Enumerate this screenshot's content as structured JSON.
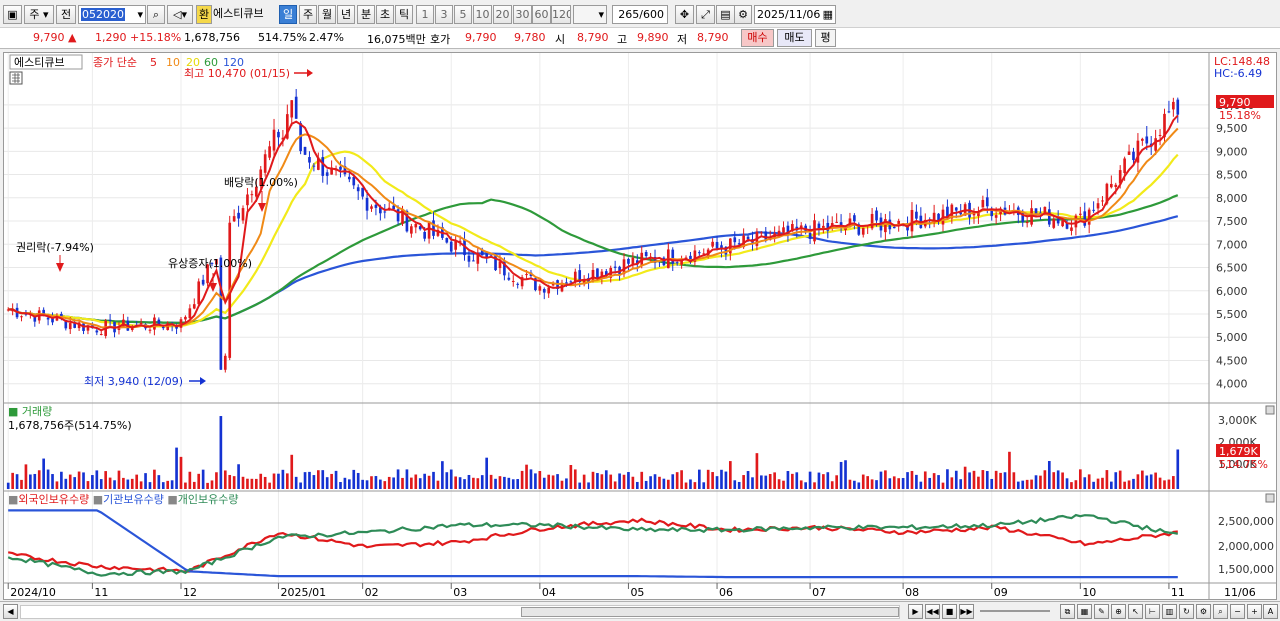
{
  "toolbar": {
    "period": "주",
    "prev": "전",
    "code": "052020",
    "exchange": "환",
    "name": "에스티큐브",
    "timeframes": [
      "일",
      "주",
      "월",
      "년",
      "분",
      "초",
      "틱"
    ],
    "selected_timeframe": "일",
    "intervals": [
      "1",
      "3",
      "5",
      "10",
      "20",
      "30",
      "60",
      "120"
    ],
    "count_display": "265/600",
    "date": "2025/11/06"
  },
  "quote": {
    "price": "9,790 ▲",
    "change": "1,290",
    "change_pct": "+15.18%",
    "volume": "1,678,756",
    "volume_ratio": "514.75%",
    "turnover_rate": "2.47%",
    "amount": "16,075백만",
    "bid_label": "호가",
    "ask": "9,790",
    "bid": "9,780",
    "open_label": "시",
    "open": "8,790",
    "high_label": "고",
    "high": "9,890",
    "low_label": "저",
    "low": "8,790",
    "buy_button": "매수",
    "sell_button": "매도",
    "eval_button": "평"
  },
  "legend": {
    "name": "에스티큐브",
    "ma_label": "종가 단순",
    "ma_periods": [
      "5",
      "10",
      "20",
      "60",
      "120"
    ],
    "ma_colors": [
      "#e0191b",
      "#f08a16",
      "#f2ea1a",
      "#2e9a3a",
      "#2a55d8"
    ]
  },
  "price_panel": {
    "lc": "LC:148.48",
    "hc": "HC:-6.49",
    "y_ticks": [
      "10,000",
      "9,500",
      "9,000",
      "8,500",
      "8,000",
      "7,500",
      "7,000",
      "6,500",
      "6,000",
      "5,500",
      "5,000",
      "4,500",
      "4,000"
    ],
    "current_price_tag": "9,790",
    "current_pct_tag": "15.18%",
    "annotations": {
      "high": "최고 10,470 (01/15)",
      "low": "최저 3,940 (12/09)",
      "rights": "권리락(-7.94%)",
      "paid_increase": "유상증자(1.00%)",
      "dividend": "배당락(1.00%)"
    }
  },
  "volume_panel": {
    "title": "거래량",
    "value": "1,678,756주(514.75%)",
    "y_ticks": [
      "3,000K",
      "2,000K",
      "1,000K"
    ],
    "current_tag": "1,679K",
    "current_pct_tag": "514.75%"
  },
  "holding_panel": {
    "series": [
      "외국인보유수량",
      "기관보유수량",
      "개인보유수량"
    ],
    "colors": [
      "#e0191b",
      "#2a55d8",
      "#2e8b57"
    ],
    "y_ticks": [
      "2,500,000",
      "2,000,000",
      "1,500,000"
    ]
  },
  "x_axis": {
    "labels": [
      "2024/10",
      "11",
      "12",
      "2025/01",
      "02",
      "03",
      "04",
      "05",
      "06",
      "07",
      "08",
      "09",
      "10",
      "11"
    ],
    "right_label": "11/06"
  },
  "chart_data": {
    "type": "candlestick",
    "title": "에스티큐브",
    "x_range": [
      "2024/10",
      "2025/11/06"
    ],
    "ylim": [
      3940,
      10470
    ],
    "monthly_close_approx": [
      {
        "x": "2024/10",
        "y": 5600
      },
      {
        "x": "2024/11",
        "y": 5200
      },
      {
        "x": "2024/12",
        "y": 5300
      },
      {
        "x": "2025/01",
        "y": 9400
      },
      {
        "x": "2025/02",
        "y": 8000
      },
      {
        "x": "2025/03",
        "y": 7000
      },
      {
        "x": "2025/04",
        "y": 6100
      },
      {
        "x": "2025/05",
        "y": 6600
      },
      {
        "x": "2025/06",
        "y": 6900
      },
      {
        "x": "2025/07",
        "y": 7300
      },
      {
        "x": "2025/08",
        "y": 7500
      },
      {
        "x": "2025/09",
        "y": 7800
      },
      {
        "x": "2025/10",
        "y": 7500
      },
      {
        "x": "2025/11",
        "y": 9790
      }
    ],
    "series": [
      {
        "name": "외국인보유수량",
        "values_approx": [
          1850000,
          1600000,
          1500000,
          2300000,
          2000000,
          2100000,
          2400000,
          2550000,
          2350000,
          2400000,
          2300000,
          2400000,
          2050000,
          2300000
        ]
      },
      {
        "name": "기관보유수량",
        "values_approx": [
          2750000,
          2750000,
          1500000,
          1400000,
          1400000,
          1400000,
          1400000,
          1400000,
          1380000,
          1380000,
          1380000,
          1380000,
          1380000,
          1380000
        ]
      },
      {
        "name": "개인보유수량",
        "values_approx": [
          1800000,
          1450000,
          1500000,
          2200000,
          2300000,
          2450000,
          2450000,
          2350000,
          2350000,
          2400000,
          2400000,
          2450000,
          2650000,
          2250000
        ]
      }
    ]
  }
}
